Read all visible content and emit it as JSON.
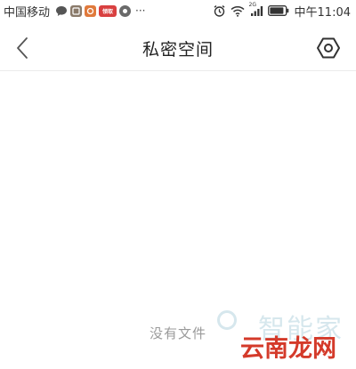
{
  "status_bar": {
    "carrier": "中国移动",
    "notification_icons": [
      "chat-bubble-icon",
      "app-icon",
      "app-icon",
      "app-icon",
      "app-icon"
    ],
    "notification_badge_text": "领取",
    "more": "···",
    "network_label": "2G",
    "time": "中午11:04"
  },
  "header": {
    "title": "私密空间",
    "back_icon": "chevron-left-icon",
    "settings_icon": "hexagon-settings-icon"
  },
  "content": {
    "empty_message": "没有文件"
  },
  "watermark": {
    "top_text": "智能家",
    "bottom_text": "云南龙网",
    "top_color": "#cfe3ea",
    "bottom_color": "#d43a2a"
  }
}
